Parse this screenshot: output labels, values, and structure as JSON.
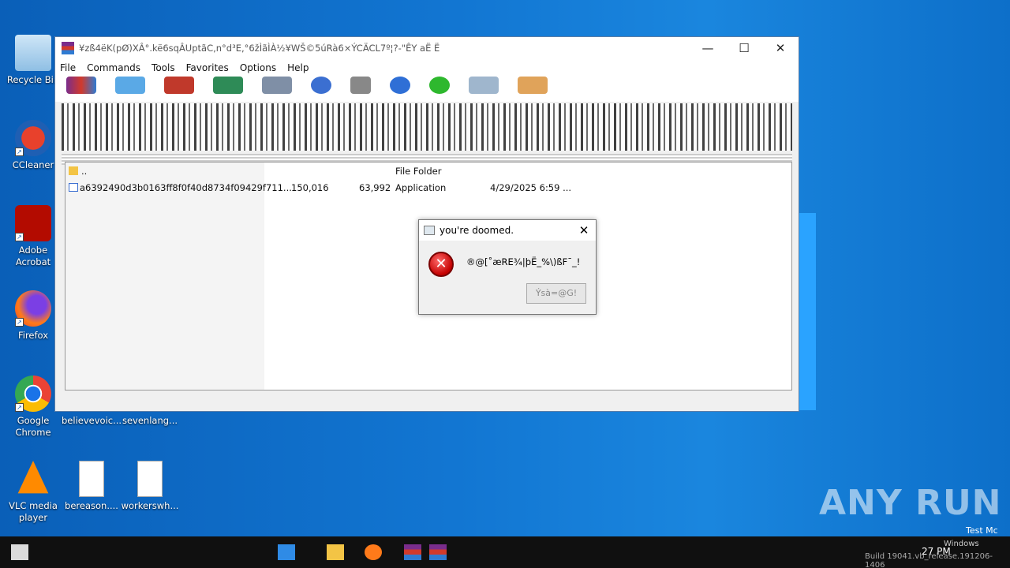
{
  "desktop": {
    "icons": [
      {
        "label": "Recycle Bin"
      },
      {
        "label": "CCleaner"
      },
      {
        "label": "Adobe Acrobat"
      },
      {
        "label": "Firefox"
      },
      {
        "label": "Google Chrome"
      },
      {
        "label": "VLC media player"
      },
      {
        "label": "believevoic..."
      },
      {
        "label": "sevenlang..."
      },
      {
        "label": "bereason...."
      },
      {
        "label": "workerswh..."
      }
    ]
  },
  "winrar": {
    "title": "¥zß4ëK(pØ)XÂ°.kë6sqÂUptãC,n°d³E,°6žÌãÌÀ½¥WŠ©5úRà6×ÝCÄCL7º¦?-\"ÊY aË Ë",
    "controls": {
      "minimize": "—",
      "maximize": "☐",
      "close": "✕"
    },
    "menu": [
      "File",
      "Commands",
      "Tools",
      "Favorites",
      "Options",
      "Help"
    ],
    "files": [
      {
        "name": "..",
        "size": "",
        "packed": "",
        "type": "File Folder",
        "modified": ""
      },
      {
        "name": "a6392490d3b0163ff8f0f40d8734f09429f711...",
        "size": "150,016",
        "packed": "63,992",
        "type": "Application",
        "modified": "4/29/2025 6:59 ..."
      }
    ]
  },
  "dialog": {
    "title": "you're doomed.",
    "close": "✕",
    "message": "®@[˚æRE¾|þË_%\\)ßF¯_!",
    "button": "Ýsà=@G!",
    "icon": "error-icon"
  },
  "taskbar": {
    "clock": "27 PM",
    "user": "Test Mc",
    "windows_text": "Windows",
    "build_text": "Build 19041.vb_release.191206-1406"
  },
  "watermark": "ANY RUN",
  "colors": {
    "desktop": "#1276d2",
    "taskbar": "#101010",
    "error": "#c40000"
  }
}
